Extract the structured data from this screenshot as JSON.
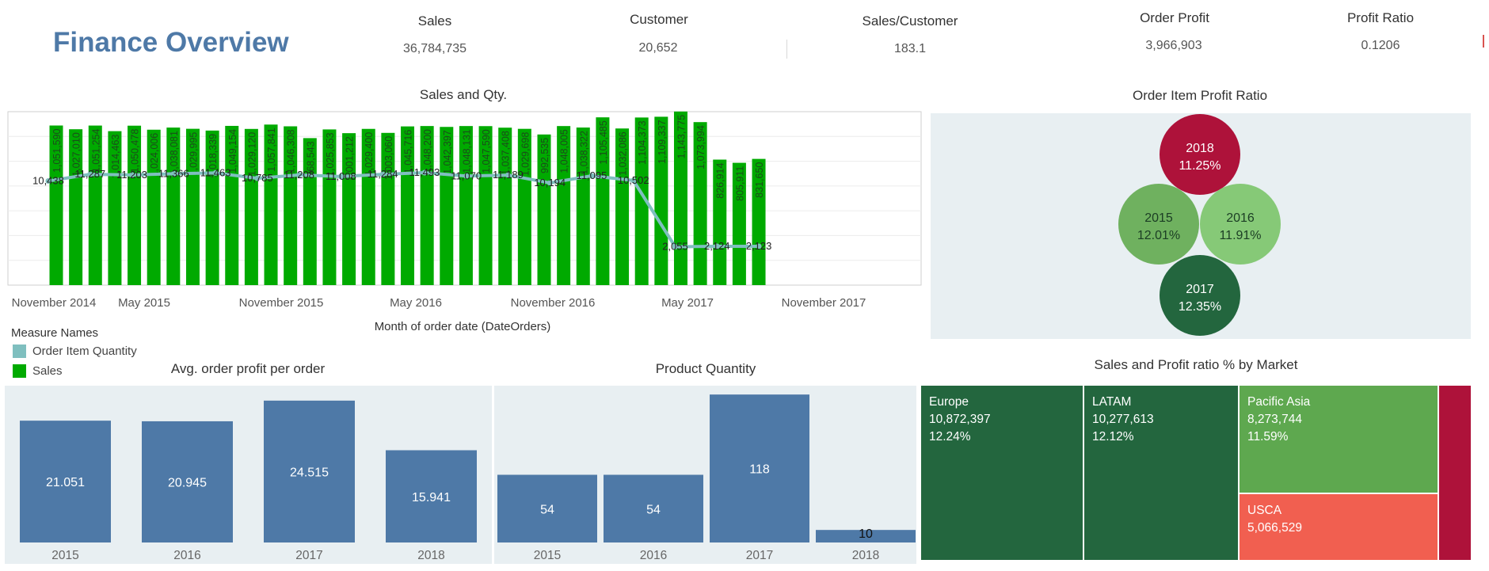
{
  "header": {
    "title": "Finance Overview"
  },
  "kpis": [
    {
      "label": "Sales",
      "value": "36,784,735"
    },
    {
      "label": "Customer",
      "value": "20,652"
    },
    {
      "label": "Sales/Customer",
      "value": "183.1"
    },
    {
      "label": "Order Profit",
      "value": "3,966,903"
    },
    {
      "label": "Profit Ratio",
      "value": "0.1206"
    }
  ],
  "colors": {
    "title": "#4e79a7",
    "sales": "#00aa00",
    "qty": "#7fbfbf",
    "bar_blue": "#4e79a7",
    "panel_bg": "#e8eff2"
  },
  "sales_qty": {
    "title": "Sales and Qty.",
    "xlabel": "Month of order date (DateOrders)",
    "x_ticks": [
      "November 2014",
      "May 2015",
      "November 2015",
      "May 2016",
      "November 2016",
      "May 2017",
      "November 2017"
    ],
    "legend_title": "Measure Names",
    "legend": [
      "Order Item Quantity",
      "Sales"
    ]
  },
  "bubbles": {
    "title": "Order Item Profit Ratio"
  },
  "avg_profit": {
    "title": "Avg. order profit per order"
  },
  "product_qty": {
    "title": "Product Quantity"
  },
  "treemap": {
    "title": "Sales and Profit ratio % by Market",
    "cells": [
      {
        "name": "Europe",
        "sales": "10,872,397",
        "ratio": "12.24%",
        "color": "#23663e"
      },
      {
        "name": "LATAM",
        "sales": "10,277,613",
        "ratio": "12.12%",
        "color": "#23663e"
      },
      {
        "name": "Pacific Asia",
        "sales": "8,273,744",
        "ratio": "11.59%",
        "color": "#5ea84f"
      },
      {
        "name": "USCA",
        "sales": "5,066,529",
        "ratio": "",
        "color": "#f15f50"
      },
      {
        "name": "",
        "sales": "",
        "ratio": "",
        "color": "#ae123a"
      }
    ]
  },
  "chart_data": [
    {
      "type": "bar",
      "title": "Sales and Qty.",
      "xlabel": "Month of order date (DateOrders)",
      "categories": [
        "Oct 2014",
        "Nov 2014",
        "Dec 2014",
        "Jan 2015",
        "Feb 2015",
        "Mar 2015",
        "Apr 2015",
        "May 2015",
        "Jun 2015",
        "Jul 2015",
        "Aug 2015",
        "Sep 2015",
        "Oct 2015",
        "Nov 2015",
        "Dec 2015",
        "Jan 2016",
        "Feb 2016",
        "Mar 2016",
        "Apr 2016",
        "May 2016",
        "Jun 2016",
        "Jul 2016",
        "Aug 2016",
        "Sep 2016",
        "Oct 2016",
        "Nov 2016",
        "Dec 2016",
        "Jan 2017",
        "Feb 2017",
        "Mar 2017",
        "Apr 2017",
        "May 2017",
        "Jun 2017",
        "Jul 2017",
        "Aug 2017",
        "Sep 2017",
        "Oct 2017",
        "Nov 2017",
        "Dec 2017",
        "Jan 2018"
      ],
      "series": [
        {
          "name": "Sales",
          "values": [
            1051590,
            1027010,
            1051254,
            1014463,
            1050478,
            1024006,
            1038081,
            1029995,
            1018339,
            1049154,
            1029120,
            1057841,
            1046308,
            968543,
            1025853,
            1001212,
            1029400,
            1003060,
            1045716,
            1048200,
            1042397,
            1048131,
            1047590,
            1037408,
            1029698,
            992535,
            1048005,
            1038322,
            1105485,
            1032086,
            1104373,
            1109337,
            1143775,
            1073994,
            826914,
            805911,
            831650
          ],
          "labels": [
            "1,051,590",
            "1,027,010",
            "1,051,254",
            "1,014,463",
            "1,050,478",
            "1,024,006",
            "1,038,081",
            "1,029,995",
            "1,018,339",
            "1,049,154",
            "1,029,120",
            "1,057,841",
            "1,046,308",
            "968,543",
            "1,025,853",
            "1,001,212",
            "1,029,400",
            "1,003,060",
            "1,045,716",
            "1,048,200",
            "1,042,397",
            "1,048,131",
            "1,047,590",
            "1,037,408",
            "1,029,698",
            "992,535",
            "1,048,005",
            "1,038,322",
            "1,105,485",
            "1,032,086",
            "1,104,373",
            "1,109,337",
            "1,143,775",
            "1,073,994",
            "826,914",
            "805,911",
            "831,650"
          ]
        },
        {
          "name": "Order Item Quantity",
          "values": [
            10438,
            11287,
            11203,
            11366,
            11463,
            10785,
            11208,
            11008,
            11284,
            11493,
            11070,
            11189,
            10194,
            11095,
            10502,
            2055,
            2124,
            2123
          ],
          "labels": [
            "10,438",
            "11,287",
            "11,203",
            "11,366",
            "11,463",
            "10,785",
            "11,208",
            "11,008",
            "11,284",
            "11,493",
            "11,070",
            "11,189",
            "10,194",
            "11,095",
            "10,502",
            "2,055",
            "2,124",
            "2,123"
          ]
        }
      ]
    },
    {
      "type": "scatter",
      "title": "Order Item Profit Ratio",
      "categories": [
        "2018",
        "2015",
        "2016",
        "2017"
      ],
      "values": [
        11.25,
        12.01,
        11.91,
        12.35
      ],
      "labels": [
        "11.25%",
        "12.01%",
        "11.91%",
        "12.35%"
      ],
      "colors": [
        "#ae123a",
        "#6fb15f",
        "#86c977",
        "#23663e"
      ]
    },
    {
      "type": "bar",
      "title": "Avg. order profit per order",
      "categories": [
        "2015",
        "2016",
        "2017",
        "2018"
      ],
      "values": [
        21.051,
        20.945,
        24.515,
        15.941
      ],
      "labels": [
        "21.051",
        "20.945",
        "24.515",
        "15.941"
      ],
      "ylim": [
        0,
        26
      ]
    },
    {
      "type": "bar",
      "title": "Product Quantity",
      "categories": [
        "2015",
        "2016",
        "2017",
        "2018"
      ],
      "values": [
        54,
        54,
        118,
        10
      ],
      "labels": [
        "54",
        "54",
        "118",
        "10"
      ],
      "ylim": [
        0,
        120
      ]
    },
    {
      "type": "table",
      "title": "Sales and Profit ratio % by Market",
      "categories": [
        "Europe",
        "LATAM",
        "Pacific Asia",
        "USCA"
      ],
      "values": [
        10872397,
        10277613,
        8273744,
        5066529
      ],
      "ratios": [
        12.24,
        12.12,
        11.59
      ]
    }
  ]
}
